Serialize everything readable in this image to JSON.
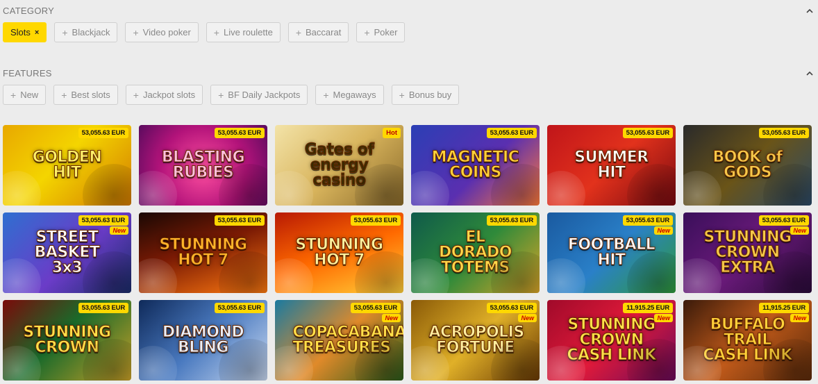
{
  "category": {
    "title": "CATEGORY",
    "chips": [
      {
        "label": "Slots",
        "active": true
      },
      {
        "label": "Blackjack",
        "active": false
      },
      {
        "label": "Video poker",
        "active": false
      },
      {
        "label": "Live roulette",
        "active": false
      },
      {
        "label": "Baccarat",
        "active": false
      },
      {
        "label": "Poker",
        "active": false
      }
    ]
  },
  "features": {
    "title": "FEATURES",
    "chips": [
      {
        "label": "New"
      },
      {
        "label": "Best slots"
      },
      {
        "label": "Jackpot slots"
      },
      {
        "label": "BF Daily Jackpots"
      },
      {
        "label": "Megaways"
      },
      {
        "label": "Bonus buy"
      }
    ]
  },
  "games": [
    {
      "title": "GOLDEN HIT",
      "jackpot": "53,055.63 EUR",
      "bg": "linear-gradient(135deg,#e8a800,#f4d500 45%,#d27a00)",
      "title_color": "#fff36b"
    },
    {
      "title": "BLASTING RUBIES",
      "jackpot": "53,055.63 EUR",
      "bg": "radial-gradient(circle at 50% 55%,#ff4fa0,#b3137a 55%,#5a0b5e)",
      "title_color": "#ffc0e0"
    },
    {
      "title": "Gates of energy casino",
      "badge": "Hot",
      "bg": "linear-gradient(135deg,#f3e3a8,#d8b45c 50%,#8a6a2a)",
      "title_color": "#3a2a00"
    },
    {
      "title": "MAGNETIC COINS",
      "jackpot": "53,055.63 EUR",
      "bg": "linear-gradient(135deg,#2b3fb5,#5a2fb0 55%,#ff7a3a)",
      "title_color": "#ffd23a"
    },
    {
      "title": "SUMMER HIT",
      "jackpot": "53,055.63 EUR",
      "bg": "linear-gradient(135deg,#c0151a,#e2321c 50%,#7a0a10)",
      "title_color": "#ffffff"
    },
    {
      "title": "BOOK of GODS",
      "jackpot": "53,055.63 EUR",
      "bg": "linear-gradient(135deg,#2a2a2a,#6a5418 50%,#2b4a68)",
      "title_color": "#f5c94a"
    },
    {
      "title": "STREET BASKET 3x3",
      "jackpot": "53,055.63 EUR",
      "new": "New",
      "bg": "linear-gradient(135deg,#2f6fd0,#6b3cc8 55%,#1a2c6a)",
      "title_color": "#ffffff"
    },
    {
      "title": "STUNNING HOT 7",
      "jackpot": "53,055.63 EUR",
      "bg": "linear-gradient(160deg,#1a0804,#7a1a04 45%,#ff7a10)",
      "title_color": "#ffb42a"
    },
    {
      "title": "STUNNING HOT 7",
      "jackpot": "53,055.63 EUR",
      "bg": "linear-gradient(160deg,#b81a04,#ff6a00 50%,#ffcf3a)",
      "title_color": "#fff4a0"
    },
    {
      "title": "EL DORADO TOTEMS",
      "jackpot": "53,055.63 EUR",
      "bg": "linear-gradient(135deg,#0f5a4a,#2f8a3a 50%,#d9a428)",
      "title_color": "#ffd84a"
    },
    {
      "title": "FOOTBALL HIT",
      "jackpot": "53,055.63 EUR",
      "new": "New",
      "bg": "linear-gradient(135deg,#1a5aa0,#2a80c8 50%,#2f9a3a)",
      "title_color": "#ffffff"
    },
    {
      "title": "STUNNING CROWN EXTRA",
      "jackpot": "53,055.63 EUR",
      "new": "New",
      "bg": "linear-gradient(135deg,#3a0f5a,#6a1a7a 50%,#2a0a3a)",
      "title_color": "#f5c94a"
    },
    {
      "title": "STUNNING CROWN",
      "jackpot": "53,055.63 EUR",
      "bg": "linear-gradient(135deg,#7a0a0a,#1a6a2a 45%,#c8a028)",
      "title_color": "#ffe14a"
    },
    {
      "title": "DIAMOND BLING",
      "jackpot": "53,055.63 EUR",
      "bg": "linear-gradient(135deg,#0f2a5a,#4a7ac0 50%,#c8d8f0)",
      "title_color": "#e8f0ff"
    },
    {
      "title": "COPACABANA TREASURES",
      "jackpot": "53,055.63 EUR",
      "new": "New",
      "bg": "linear-gradient(135deg,#1a7aa0,#e08a2a 50%,#2a5a1a)",
      "title_color": "#ffe14a"
    },
    {
      "title": "ACROPOLIS FORTUNE",
      "jackpot": "53,055.63 EUR",
      "new": "New",
      "bg": "linear-gradient(135deg,#8a5a08,#e0b028 50%,#6a3a04)",
      "title_color": "#fff0a0"
    },
    {
      "title": "STUNNING CROWN CASH LINK",
      "jackpot": "11,915.25 EUR",
      "new": "New",
      "bg": "linear-gradient(135deg,#a00a2a,#e01a3a 50%,#6a0a5a)",
      "title_color": "#ffe14a"
    },
    {
      "title": "BUFFALO TRAIL CASH LINK",
      "jackpot": "11,915.25 EUR",
      "new": "New",
      "bg": "linear-gradient(135deg,#3a1a0a,#c05a1a 50%,#5a2a0a)",
      "title_color": "#ffd23a"
    }
  ]
}
